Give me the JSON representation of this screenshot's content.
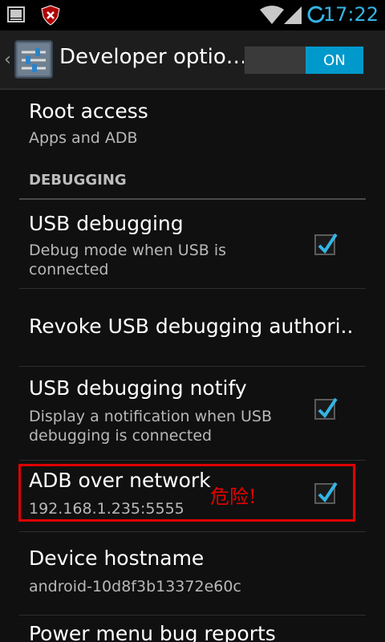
{
  "status_bar": {
    "time": "17:22",
    "icons": [
      "screenshot-icon",
      "shield-icon",
      "wifi-icon",
      "signal-icon",
      "battery-loading-icon"
    ]
  },
  "action_bar": {
    "title": "Developer optio…",
    "switch_label": "ON",
    "icon": "settings-sliders-icon"
  },
  "list": {
    "root_access": {
      "title": "Root access",
      "summary": "Apps and ADB"
    },
    "debugging_header": "DEBUGGING",
    "usb_debugging": {
      "title": "USB debugging",
      "summary": "Debug mode when USB is connected",
      "checked": true
    },
    "revoke": {
      "title": "Revoke USB debugging authori.."
    },
    "usb_notify": {
      "title": "USB debugging notify",
      "summary": "Display a notification when USB debugging is connected",
      "checked": true
    },
    "adb_network": {
      "title": "ADB over network",
      "summary": "192.168.1.235:5555",
      "checked": true,
      "annotation": "危险!"
    },
    "hostname": {
      "title": "Device hostname",
      "summary": "android-10d8f3b13372e60c"
    },
    "power_menu": {
      "title": "Power menu bug reports"
    }
  },
  "colors": {
    "accent": "#33b5e5",
    "switch_on": "#0099cc",
    "highlight": "#e00000",
    "background": "#101010"
  }
}
